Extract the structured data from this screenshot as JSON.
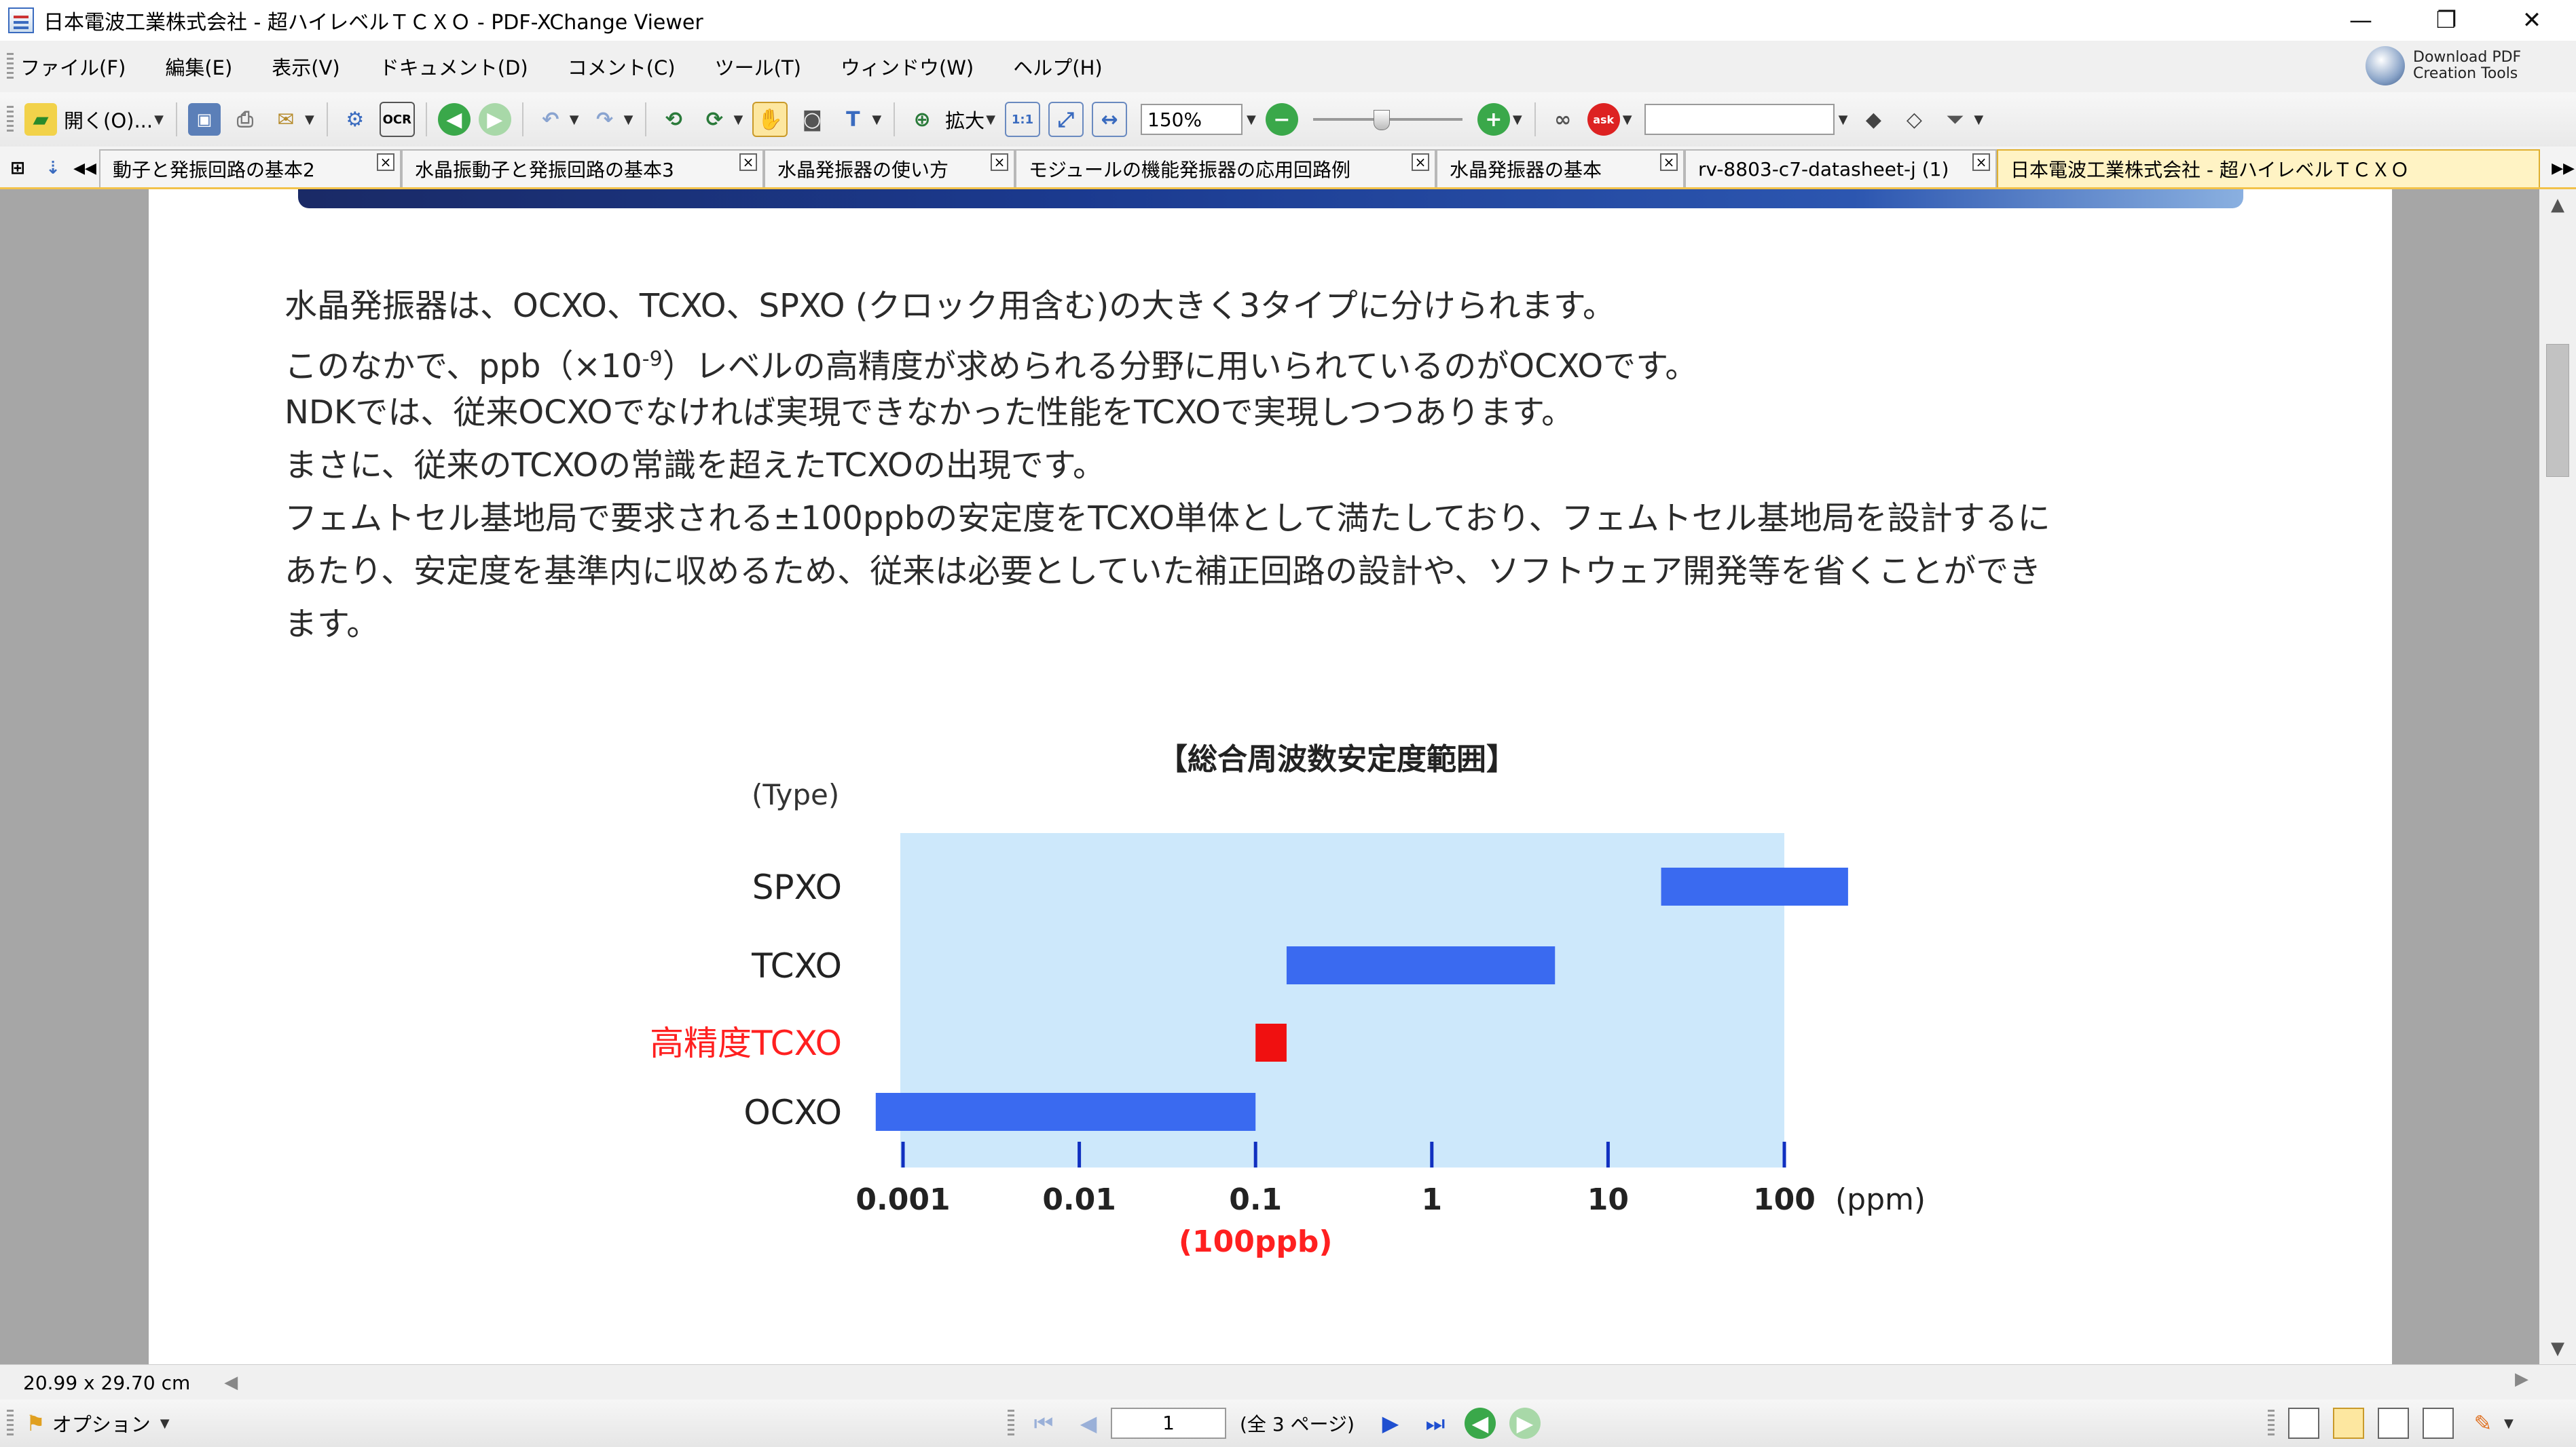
{
  "window": {
    "title": "日本電波工業株式会社 - 超ハイレベルＴＣＸＯ - PDF-XChange Viewer",
    "minimize": "—",
    "restore": "❐",
    "close": "✕"
  },
  "menu": [
    "ファイル(F)",
    "編集(E)",
    "表示(V)",
    "ドキュメント(D)",
    "コメント(C)",
    "ツール(T)",
    "ウィンドウ(W)",
    "ヘルプ(H)"
  ],
  "download_tools": {
    "line1": "Download PDF",
    "line2": "Creation Tools"
  },
  "toolbar": {
    "open_label": "開く(O)...",
    "ocr_label": "OCR",
    "zoom_in_label": "拡大",
    "zoom_value": "150%",
    "zoom_slider_level": 0.45,
    "search_value": ""
  },
  "tabs": [
    {
      "label": "動子と発振回路の基本2",
      "active": false
    },
    {
      "label": "水晶振動子と発振回路の基本3",
      "active": false
    },
    {
      "label": "水晶発振器の使い方",
      "active": false
    },
    {
      "label": "モジュールの機能発振器の応用回路例",
      "active": false
    },
    {
      "label": "水晶発振器の基本",
      "active": false
    },
    {
      "label": "rv-8803-c7-datasheet-j (1)",
      "active": false
    },
    {
      "label": "日本電波工業株式会社 - 超ハイレベルＴＣＸＯ",
      "active": true
    }
  ],
  "document": {
    "paragraphs": [
      "水晶発振器は、OCXO、TCXO、SPXO (クロック用含む)の大きく3タイプに分けられます。",
      "NDKでは、従来OCXOでなければ実現できなかった性能をTCXOで実現しつつあります。",
      "まさに、従来のTCXOの常識を超えたTCXOの出現です。",
      "フェムトセル基地局で要求される±100ppbの安定度をTCXO単体として満たしており、フェムトセル基地局を設計するに",
      "あたり、安定度を基準内に収めるため、従来は必要としていた補正回路の設計や、ソフトウェア開発等を省くことができ",
      "ます。"
    ],
    "para2": {
      "before": "このなかで、ppb（×10",
      "sup": "-9",
      "after": "）レベルの高精度が求められる分野に用いられているのがOCXOです。"
    }
  },
  "chart_data": {
    "type": "bar",
    "orientation": "horizontal-range",
    "title": "【総合周波数安定度範囲】",
    "ylabel": "(Type)",
    "xlabel": "(ppm)",
    "xscale": "log",
    "xlim": [
      0.0007,
      100
    ],
    "xticks": [
      "0.001",
      "0.01",
      "0.1",
      "1",
      "10",
      "100"
    ],
    "tick_values": [
      0.001,
      0.01,
      0.1,
      1,
      10,
      100
    ],
    "annotation": "(100ppb)",
    "annotation_at": 0.1,
    "shaded_region": [
      0.001,
      100
    ],
    "categories": [
      "SPXO",
      "TCXO",
      "高精度TCXO",
      "OCXO"
    ],
    "ranges": [
      [
        20,
        230
      ],
      [
        0.15,
        5
      ],
      [
        0.1,
        0.15
      ],
      [
        0.0007,
        0.1
      ]
    ],
    "colors": {
      "bar": "#3a6af0",
      "highlight": "#f01010",
      "region": "#cde8fb",
      "tick": "#1030c0",
      "highlight_label": "#ff2020"
    },
    "highlight_category": "高精度TCXO"
  },
  "status": {
    "page_size": "20.99 x 29.70 cm"
  },
  "bottom": {
    "options_label": "オプション",
    "current_page": "1",
    "page_count": "(全 3 ページ)"
  }
}
